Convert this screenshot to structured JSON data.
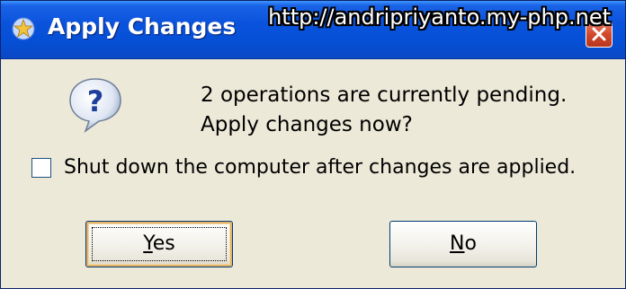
{
  "window": {
    "title": "Apply Changes",
    "watermark": "http://andripriyanto.my-php.net"
  },
  "dialog": {
    "message_line1": "2 operations are currently pending.",
    "message_line2": "Apply changes now?",
    "checkbox_label": "Shut down the computer after changes are applied.",
    "checkbox_checked": false
  },
  "buttons": {
    "yes": {
      "mnemonic": "Y",
      "rest": "es"
    },
    "no": {
      "mnemonic": "N",
      "rest": "o"
    }
  },
  "icons": {
    "title": "app-star-icon",
    "close": "close-icon",
    "message": "question-icon",
    "checkbox": "checkbox-unchecked-icon"
  },
  "colors": {
    "titlebar": "#0550d6",
    "window_bg": "#ece9d8",
    "close_button": "#d2492c",
    "default_button_highlight": "#e3b26a"
  }
}
